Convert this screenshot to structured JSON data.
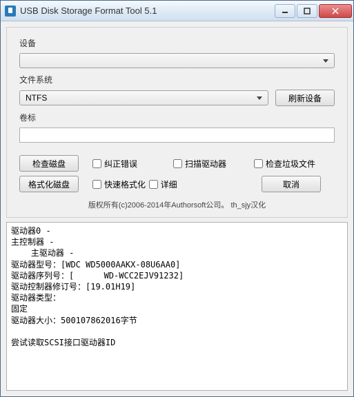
{
  "window": {
    "title": "USB Disk Storage Format Tool 5.1"
  },
  "labels": {
    "device": "设备",
    "filesystem": "文件系统",
    "volumelabel": "卷标"
  },
  "combos": {
    "device": "",
    "filesystem": "NTFS"
  },
  "inputs": {
    "volumelabel": ""
  },
  "buttons": {
    "refresh": "刷新设备",
    "checkdisk": "检查磁盘",
    "formatdisk": "格式化磁盘",
    "cancel": "取消"
  },
  "checks": {
    "correct_errors": "纠正错误",
    "scan_drive": "扫描驱动器",
    "check_junk": "检查垃圾文件",
    "quick_format": "快速格式化",
    "verbose": "详细"
  },
  "copyright": "版权所有(c)2006-2014年Authorsoft公司。  th_sjy汉化",
  "log": "驱动器0 -\n主控制器 -\n    主驱动器 -\n驱动器型号：[WDC WD5000AAKX-08U6AA0]\n驱动器序列号：[      WD-WCC2EJV91232]\n驱动控制器修订号：[19.01H19]\n驱动器类型：\n固定\n驱动器大小：500107862016字节\n\n尝试读取SCSI接口驱动器ID"
}
